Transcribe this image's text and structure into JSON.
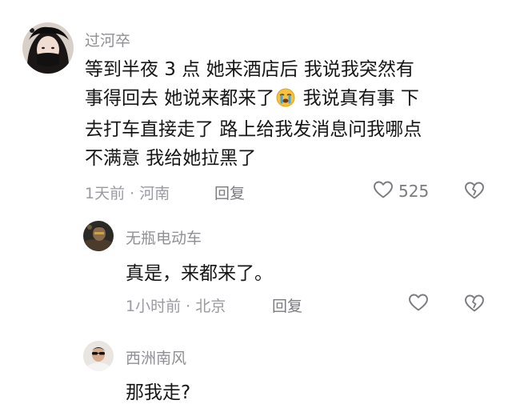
{
  "comments": [
    {
      "username": "过河卒",
      "lines": [
        "等到半夜 3 点   她来酒店后   我说我突然有",
        "事得回去  她说来都来了",
        "去打车直接走了  路上给我发消息问我哪点",
        "不满意  我给她拉黑了"
      ],
      "line2_tail": "  我说真有事  下",
      "emoji": "crying-face",
      "meta": "1天前 · 河南",
      "reply_label": "回复",
      "like_count": "525"
    },
    {
      "username": "无瓶电动车",
      "text": "真是，来都来了。",
      "meta": "1小时前 · 北京",
      "reply_label": "回复"
    },
    {
      "username": "西洲南风",
      "text": "那我走?"
    }
  ],
  "colors": {
    "text": "#161616",
    "username": "#8f8f94",
    "meta": "#9a9aa0",
    "icon": "#7b7b80"
  }
}
